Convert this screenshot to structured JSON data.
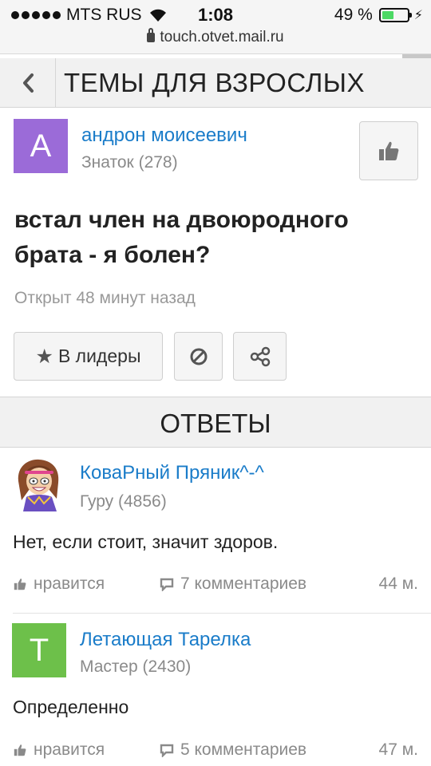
{
  "status_bar": {
    "carrier": "MTS RUS",
    "time": "1:08",
    "battery_percent": "49 %",
    "battery_level": 0.49,
    "url": "touch.otvet.mail.ru"
  },
  "header": {
    "title": "ТЕМЫ ДЛЯ ВЗРОСЛЫХ"
  },
  "question": {
    "author": {
      "avatar_letter": "А",
      "avatar_color": "#9b6bd8",
      "name": "андрон моисеевич",
      "rank": "Знаток (278)"
    },
    "text": "встал член на двоюродного брата - я болен?",
    "opened": "Открыт 48 минут назад",
    "leaders_label": "В лидеры"
  },
  "answers_section": {
    "title": "ОТВЕТЫ"
  },
  "answers": [
    {
      "author_name": "КоваРный Пряник^-^",
      "author_rank": "Гуру (4856)",
      "text": "Нет, если стоит, значит здоров.",
      "like_label": "нравится",
      "comments": "7 комментариев",
      "time": "44 м."
    },
    {
      "avatar_letter": "Т",
      "avatar_color": "#6dc04a",
      "author_name": "Летающая Тарелка",
      "author_rank": "Мастер (2430)",
      "text": "Определенно",
      "like_label": "нравится",
      "comments": "5 комментариев",
      "time": "47 м."
    }
  ],
  "colors": {
    "link": "#1a7cc9",
    "muted": "#8a8a8a"
  }
}
